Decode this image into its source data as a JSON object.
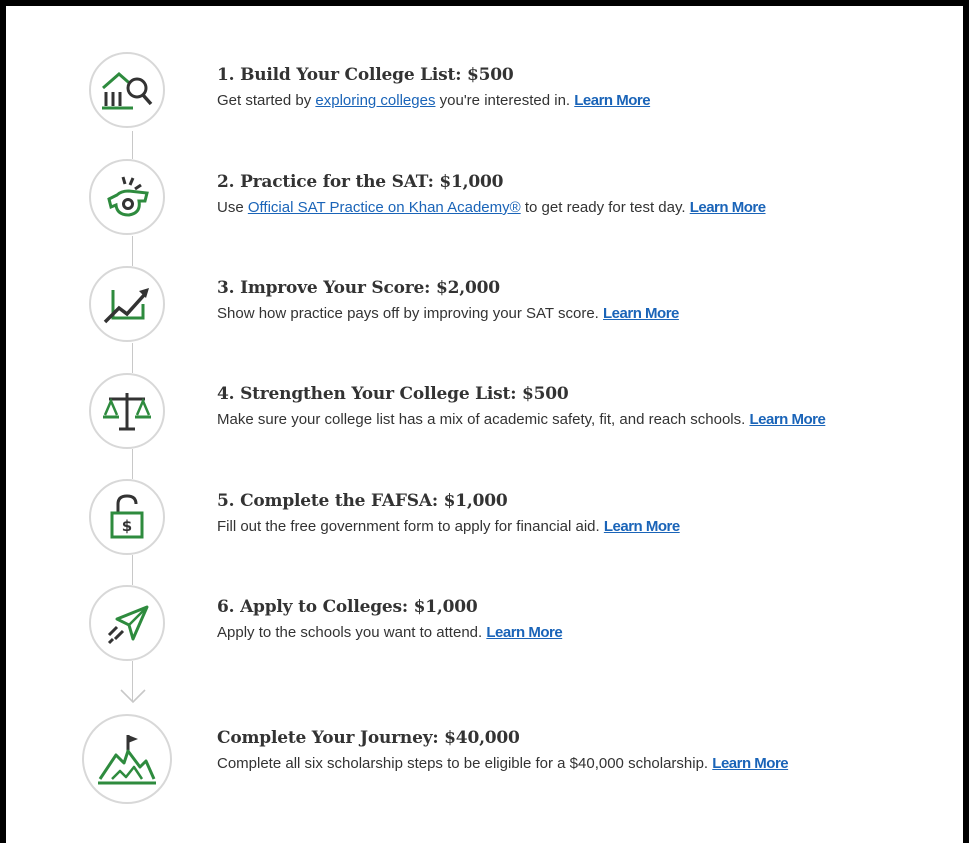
{
  "colors": {
    "icon_green": "#2e8b3e",
    "icon_dark": "#333333",
    "link_blue": "#1a64b8",
    "circle_border": "#d8d8d8"
  },
  "steps": [
    {
      "title": "1. Build Your College List: $500",
      "desc_before": "Get started by ",
      "desc_link": "exploring colleges",
      "desc_after": " you're interested in. ",
      "learn_more": "Learn More",
      "icon": "college-search-icon"
    },
    {
      "title": "2. Practice for the SAT: $1,000",
      "desc_before": "Use ",
      "desc_link": "Official SAT Practice on Khan Academy®",
      "desc_after": " to get ready for test day. ",
      "learn_more": "Learn More",
      "icon": "whistle-icon"
    },
    {
      "title": "3. Improve Your Score: $2,000",
      "desc_before": "Show how practice pays off by improving your SAT score. ",
      "learn_more": "Learn More",
      "icon": "growth-chart-icon"
    },
    {
      "title": "4. Strengthen Your College List: $500",
      "desc_before": "Make sure your college list has a mix of academic safety, fit, and reach schools. ",
      "learn_more": "Learn More",
      "icon": "balance-scale-icon"
    },
    {
      "title": "5. Complete the FAFSA: $1,000",
      "desc_before": "Fill out the free government form to apply for financial aid. ",
      "learn_more": "Learn More",
      "icon": "unlocked-padlock-dollar-icon"
    },
    {
      "title": "6. Apply to Colleges: $1,000",
      "desc_before": "Apply to the schools you want to attend. ",
      "learn_more": "Learn More",
      "icon": "paper-plane-icon"
    },
    {
      "title": "Complete Your Journey: $40,000",
      "desc_before": "Complete all six scholarship steps to be eligible for a $40,000 scholarship. ",
      "learn_more": "Learn More",
      "icon": "mountain-flag-icon"
    }
  ]
}
